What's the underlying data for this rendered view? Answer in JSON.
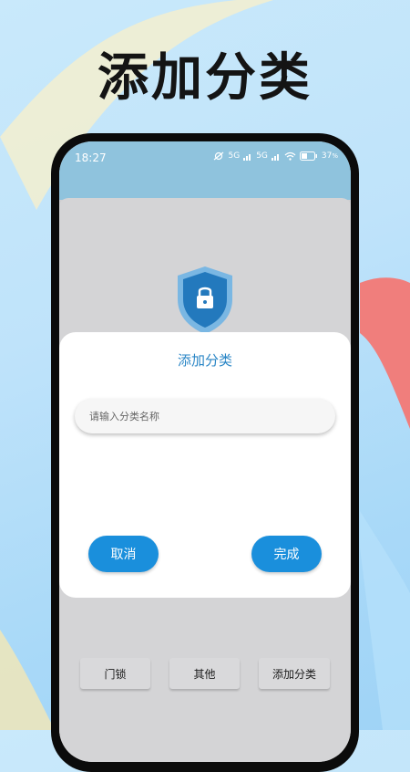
{
  "headline": "添加分类",
  "status_bar": {
    "time": "18:27",
    "network_label_1": "5G",
    "network_label_2": "5G",
    "battery": "37",
    "battery_unit": "%"
  },
  "dialog": {
    "title": "添加分类",
    "input_placeholder": "请输入分类名称",
    "input_value": "",
    "cancel_label": "取消",
    "done_label": "完成"
  },
  "categories": [
    {
      "label": "门锁"
    },
    {
      "label": "其他"
    },
    {
      "label": "添加分类"
    }
  ],
  "icons": {
    "shield": "shield-lock-icon",
    "wifi": "wifi-icon",
    "signal": "signal-icon",
    "battery": "battery-icon",
    "alarm": "alarm-off-icon"
  },
  "colors": {
    "accent": "#1a8fdc",
    "title": "#2a86c6",
    "status_bar": "#8fc3dd"
  }
}
